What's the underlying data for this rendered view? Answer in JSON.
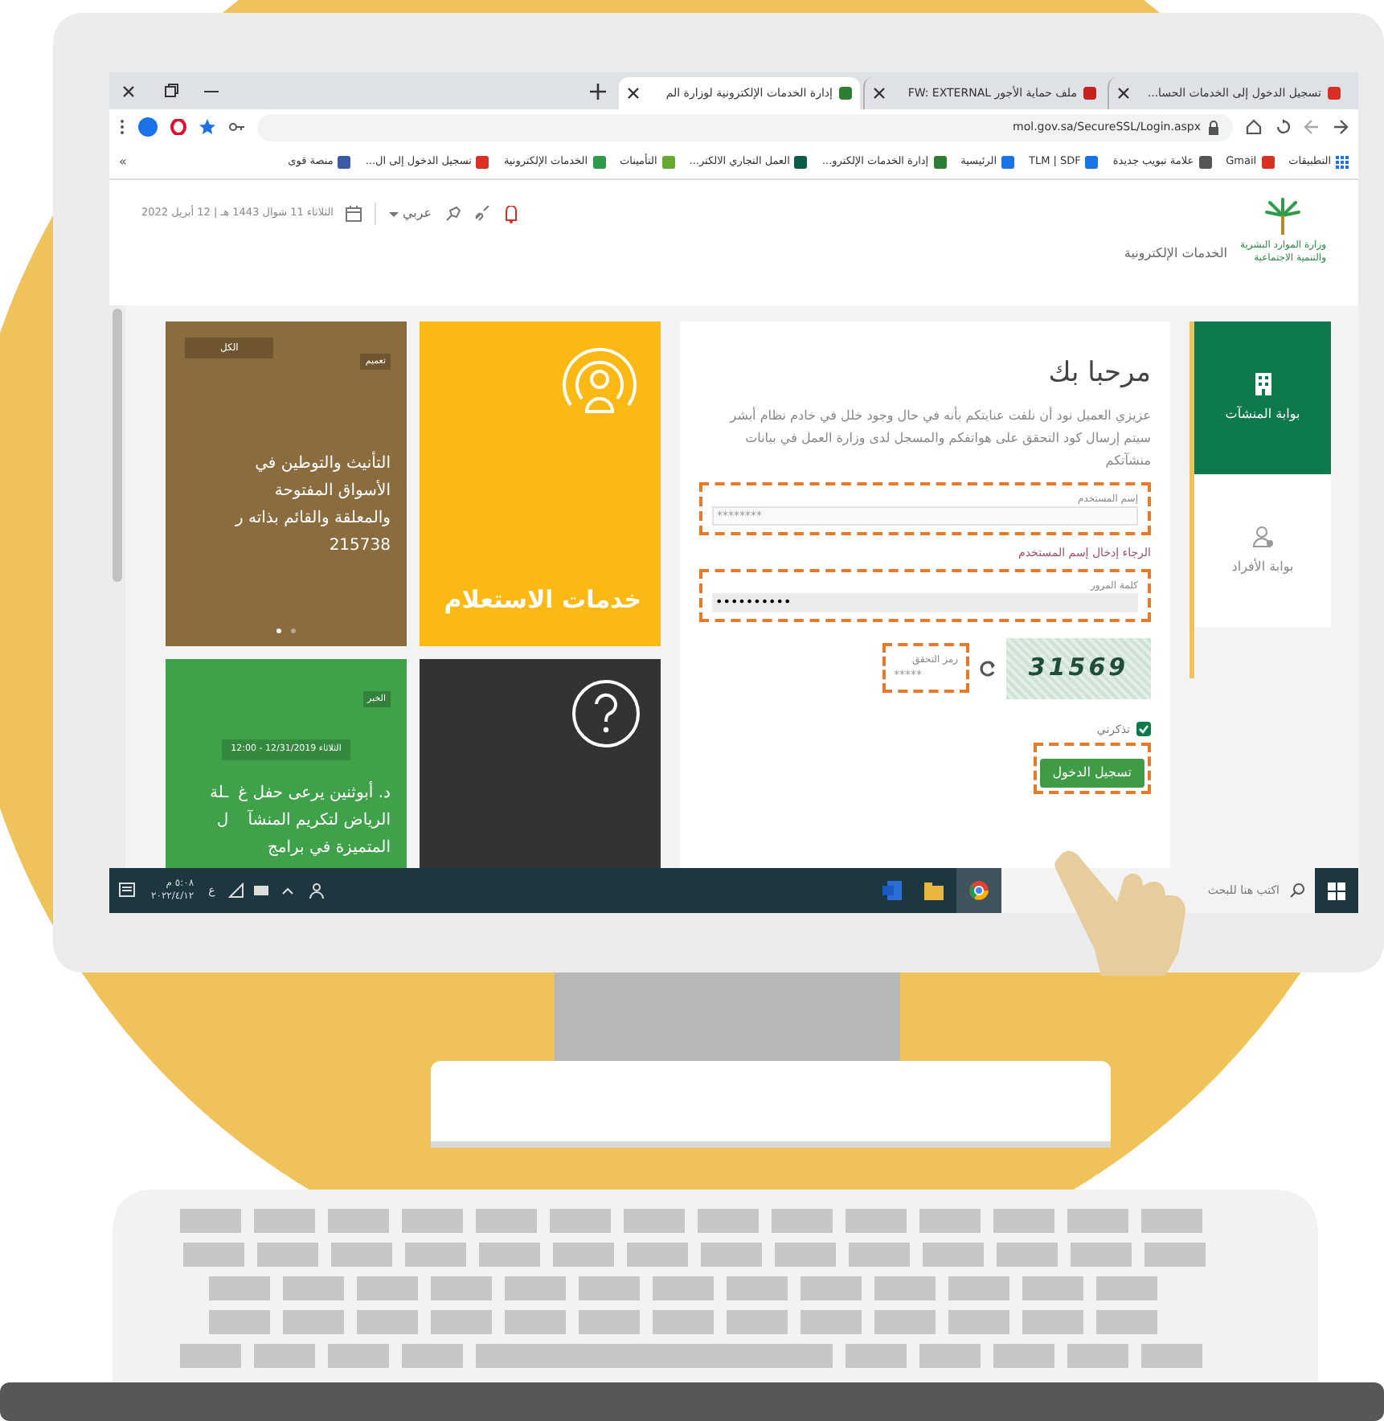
{
  "tabs": [
    {
      "title": "تسجيل الدخول إلى الخدمات الحسا...",
      "selected": false
    },
    {
      "title": "ملف حماية الأجور FW: EXTERNAL",
      "selected": false
    },
    {
      "title": "إدارة الخدمات الإلكترونية لوزارة الم",
      "selected": true
    }
  ],
  "address_bar": {
    "url": "mol.gov.sa/SecureSSL/Login.aspx"
  },
  "bookmarks": [
    {
      "label": "التطبيقات"
    },
    {
      "label": "Gmail"
    },
    {
      "label": "علامة تبويب جديدة"
    },
    {
      "label": "TLM | SDF"
    },
    {
      "label": "الرئيسية"
    },
    {
      "label": "إدارة الخدمات الإلكترو..."
    },
    {
      "label": "العمل التجاري الالكتر..."
    },
    {
      "label": "التأمينات"
    },
    {
      "label": "الخدمات الإلكترونية"
    },
    {
      "label": "تسجيل الدخول إلى ال..."
    },
    {
      "label": "منصة قوى"
    }
  ],
  "bookmarks_more": "»",
  "header": {
    "ministry": "وزارة الموارد البشرية\nوالتنمية الاجتماعية",
    "section": "الخدمات الإلكترونية",
    "language": "عربي",
    "date": "الثلاثاء 11 شوال 1443 هـ | 12 أبريل 2022"
  },
  "portals": [
    {
      "label": "بوابة المنشآت",
      "selected": true
    },
    {
      "label": "بوابة الأفراد",
      "selected": false
    }
  ],
  "login": {
    "title": "مرحبا بك",
    "notice": "عزيزي العميل نود أن نلفت عنايتكم بأنه في حال وجود خلل في خادم نظام أبشر سيتم إرسال كود التحقق على هواتفكم والمسجل لدى وزارة العمل في بيانات منشآتكم",
    "username": {
      "label": "إسم المستخدم",
      "placeholder": "********",
      "highlighted": true
    },
    "error": "الرجاء إدخال إسم المستخدم",
    "password": {
      "label": "كلمة المرور",
      "value": "••••••••••",
      "highlighted": true
    },
    "captcha": {
      "label": "رمز التحقق",
      "placeholder": "*****",
      "code": "31569",
      "highlighted": true
    },
    "remember": {
      "label": "تذكرني",
      "checked": true
    },
    "submit": {
      "label": "تسجيل الدخول",
      "highlighted": true
    }
  },
  "tiles": [
    {
      "kind": "service",
      "color": "#fdb913",
      "label": "خدمات الاستعلام"
    },
    {
      "kind": "news",
      "color": "#8b6c3e",
      "tag": "تعميم",
      "filter": "الكل",
      "text": "التأنيث والتوطين في\nالأسواق المفتوحة\nوالمعلقة والقائم بذاته ر\n215738",
      "dots": [
        {
          "selected": false
        },
        {
          "selected": true
        }
      ]
    },
    {
      "kind": "help",
      "color": "#333333"
    },
    {
      "kind": "news",
      "color": "#3fa24a",
      "tag": "الخبر",
      "date": "الثلاثاء 12/31/2019 - 12:00",
      "text": "د. أبوثنين يرعى حفل غ\nالرياض لتكريم المنشآ\nالمتميزة في برامج",
      "side": "ـلة\nل"
    }
  ],
  "taskbar": {
    "search_placeholder": "اكتب هنا للبحث",
    "language": "ع",
    "time": "٥:٠٨ م",
    "date": "٢٠٢٢/٤/١٢"
  }
}
